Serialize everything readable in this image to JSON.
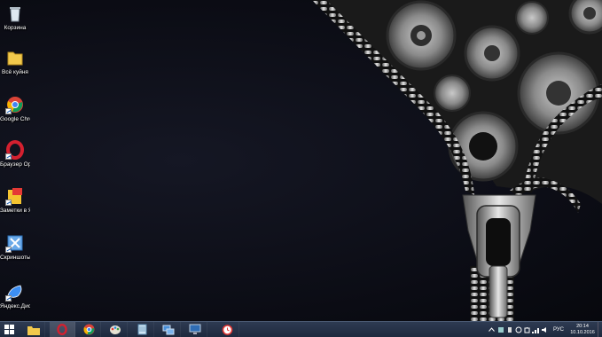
{
  "desktop_icons": [
    {
      "name": "recycle-bin-icon",
      "label": "Корзина"
    },
    {
      "name": "folder-icon",
      "label": "Всё куйня"
    },
    {
      "name": "google-chrome-icon",
      "label": "Google Chrome"
    },
    {
      "name": "opera-icon",
      "label": "Браузер Opera"
    },
    {
      "name": "yandex-notes-icon",
      "label": "Заметки в Яндекс.Ди..."
    },
    {
      "name": "yandex-screenshots-icon",
      "label": "Скриншоты в Яндекс.Д..."
    },
    {
      "name": "yandex-disk-icon",
      "label": "Яндекс.Диск"
    }
  ],
  "taskbar": {
    "start": "windows-start-icon",
    "pinned": [
      "file-explorer-icon",
      "opera-icon",
      "chrome-icon",
      "paint-icon",
      "notepad-icon",
      "network-icon",
      "remote-desktop-icon",
      "alarm-clock-icon"
    ],
    "tray": {
      "language": "РУС",
      "time": "20:14",
      "date": "10.10.2016"
    }
  },
  "colors": {
    "taskbar": "#25324a",
    "desktop": "#0e0f1a",
    "accent_red": "#d4202f"
  }
}
